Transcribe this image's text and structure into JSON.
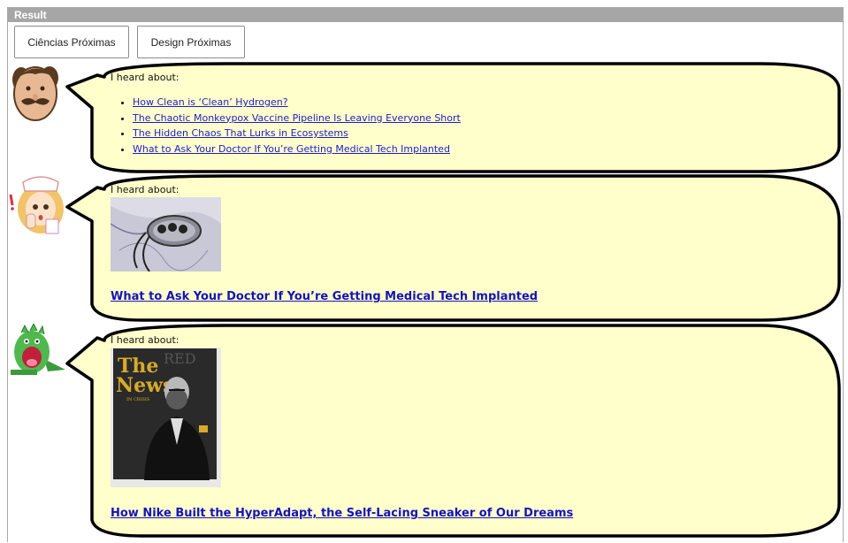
{
  "panel": {
    "title": "Result"
  },
  "buttons": {
    "ciencias": "Ciências Próximas",
    "design": "Design Próximas"
  },
  "bubble1": {
    "heard": "I heard about:",
    "links": [
      "How Clean is ‘Clean’ Hydrogen?",
      "The Chaotic Monkeypox Vaccine Pipeline Is Leaving Everyone Short",
      "The Hidden Chaos That Lurks in Ecosystems",
      "What to Ask Your Doctor If You’re Getting Medical Tech Implanted"
    ]
  },
  "bubble2": {
    "heard": "I heard about:",
    "title": "What to Ask Your Doctor If You’re Getting Medical Tech Implanted"
  },
  "bubble3": {
    "heard": "I heard about:",
    "magazine": {
      "masthead": "RED",
      "headline1": "The",
      "headline2": "News",
      "sub": "IN CRISIS"
    },
    "title": "How Nike Built the HyperAdapt, the Self-Lacing Sneaker of Our Dreams"
  },
  "colors": {
    "bubble_fill": "#ffffcc",
    "header": "#a6a6a6",
    "link": "#1a0dab"
  }
}
